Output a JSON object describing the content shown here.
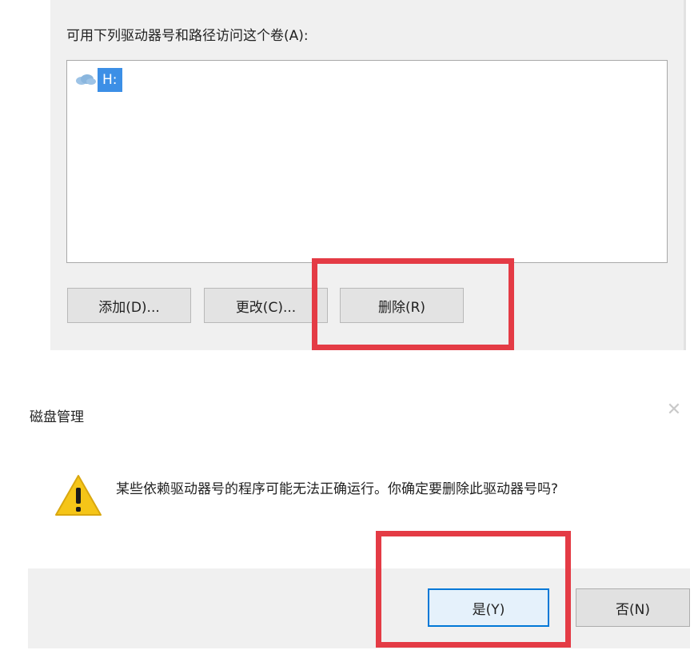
{
  "drive_panel": {
    "label": "可用下列驱动器号和路径访问这个卷(A):",
    "drives": [
      {
        "icon": "drive-icon",
        "label": "H:"
      }
    ],
    "buttons": {
      "add": "添加(D)...",
      "change": "更改(C)...",
      "delete": "删除(R)"
    }
  },
  "confirm_dialog": {
    "title": "磁盘管理",
    "close_icon": "close-icon",
    "warning_icon": "warning-icon",
    "message": "某些依赖驱动器号的程序可能无法正确运行。你确定要删除此驱动器号吗?",
    "buttons": {
      "yes": "是(Y)",
      "no": "否(N)"
    }
  },
  "colors": {
    "highlight": "#e43b45",
    "selection": "#3c8fe6",
    "focus_border": "#0078d7",
    "warning": "#f5c518"
  }
}
